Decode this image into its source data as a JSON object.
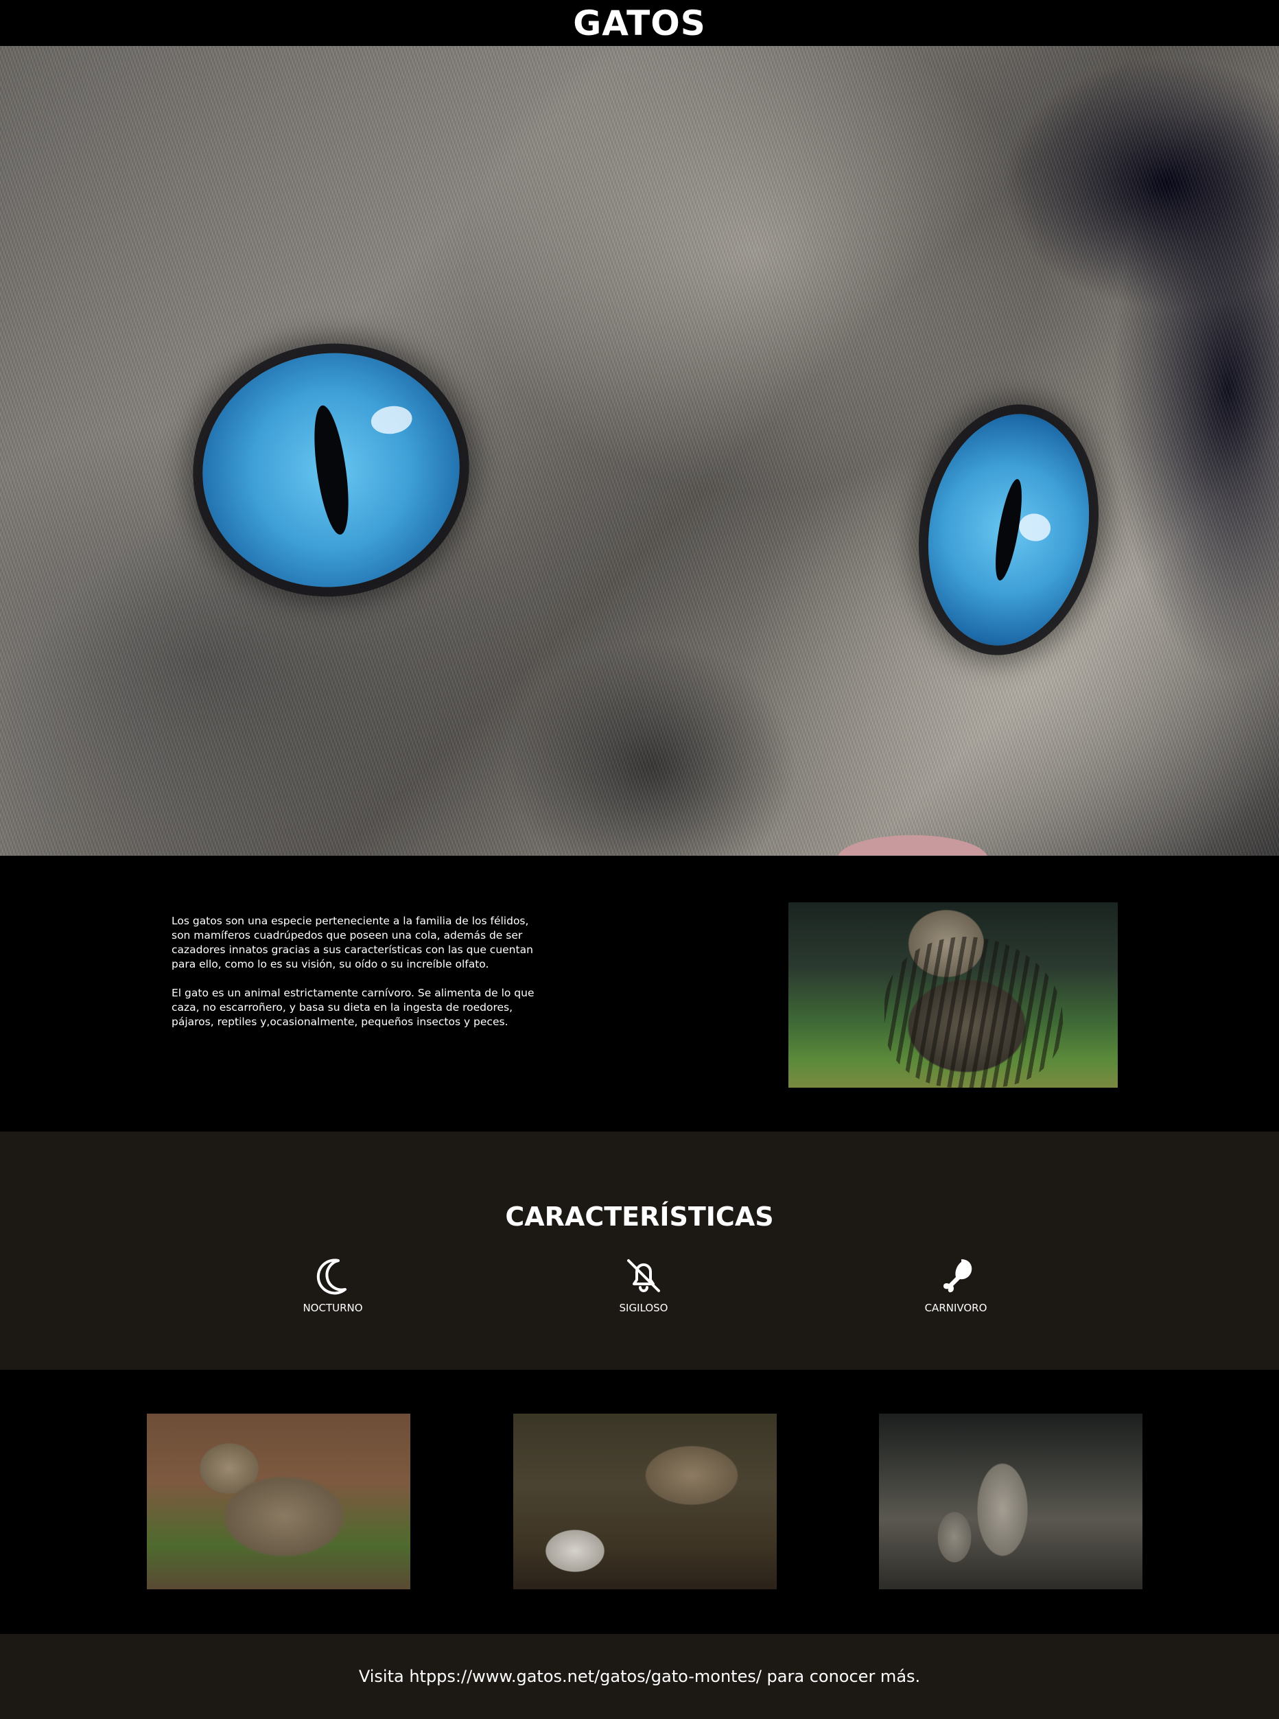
{
  "header": {
    "title": "GATOS"
  },
  "hero": {
    "image": "cat-eyes-closeup"
  },
  "intro": {
    "paragraph_1": "Los gatos son una especie perteneciente a la familia de los félidos, son mamíferos cuadrúpedos que poseen una cola, además de ser cazadores innatos gracias a sus características con las que cuentan para ello, como lo es su visión, su oído o su increíble olfato.",
    "paragraph_2": "El gato es un animal estrictamente carnívoro. Se alimenta de lo que caza, no escarroñero, y basa su dieta en la ingesta de roedores, pájaros, reptiles y,ocasionalmente, pequeños insectos y peces.",
    "image": "wildcat-in-grass"
  },
  "features": {
    "title": "CARACTERÍSTICAS",
    "items": [
      {
        "label": "NOCTURNO",
        "icon": "moon-icon"
      },
      {
        "label": "SIGILOSO",
        "icon": "bell-slash-icon"
      },
      {
        "label": "CARNIVORO",
        "icon": "drumstick-icon"
      }
    ]
  },
  "gallery": {
    "images": [
      "wildcat-sitting",
      "wildcat-eating-prey",
      "wildcat-with-kitten"
    ]
  },
  "footer": {
    "text": "Visita htpps://www.gatos.net/gatos/gato-montes/ para conocer más."
  },
  "colors": {
    "background": "#000000",
    "section_dark": "#1c1813",
    "text": "#ffffff"
  }
}
